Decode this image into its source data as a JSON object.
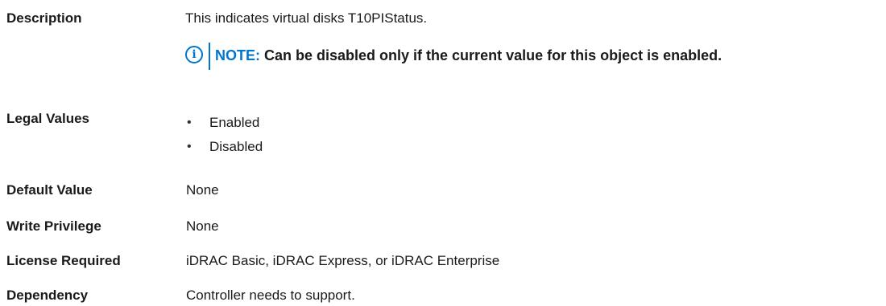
{
  "rows": {
    "description": {
      "label": "Description",
      "value": "This indicates virtual disks T10PIStatus.",
      "note": {
        "icon": "info-icon",
        "prefix": "NOTE:",
        "text": "Can be disabled only if the current value for this object is enabled."
      }
    },
    "legal_values": {
      "label": "Legal Values",
      "items": [
        "Enabled",
        "Disabled"
      ]
    },
    "default_value": {
      "label": "Default Value",
      "value": "None"
    },
    "write_privilege": {
      "label": "Write Privilege",
      "value": "None"
    },
    "license_required": {
      "label": "License Required",
      "value": "iDRAC Basic, iDRAC Express, or iDRAC Enterprise"
    },
    "dependency": {
      "label": "Dependency",
      "value": "Controller needs to support."
    }
  },
  "colors": {
    "accent": "#0076ce",
    "text": "#1a1a1a"
  }
}
